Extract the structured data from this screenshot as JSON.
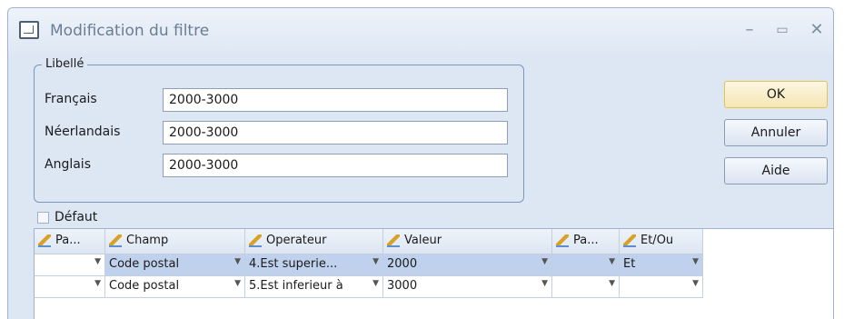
{
  "window": {
    "title": "Modification du filtre"
  },
  "libelle": {
    "legend": "Libellé",
    "fields": [
      {
        "label": "Français",
        "value": "2000-3000"
      },
      {
        "label": "Néerlandais",
        "value": "2000-3000"
      },
      {
        "label": "Anglais",
        "value": "2000-3000"
      }
    ]
  },
  "buttons": {
    "ok": "OK",
    "cancel": "Annuler",
    "help": "Aide"
  },
  "default_checkbox": {
    "label": "Défaut",
    "checked": false
  },
  "grid": {
    "columns": [
      "Pa...",
      "Champ",
      "Operateur",
      "Valeur",
      "Pa...",
      "Et/Ou"
    ],
    "rows": [
      [
        "",
        "Code postal",
        "4.Est superie...",
        "2000",
        "",
        "Et"
      ],
      [
        "",
        "Code postal",
        "5.Est inferieur à",
        "3000",
        "",
        ""
      ]
    ]
  },
  "icons": {
    "app": "filter-window-icon",
    "column_edit": "pencil-icon",
    "dropdown": "dropdown-arrow-icon"
  }
}
